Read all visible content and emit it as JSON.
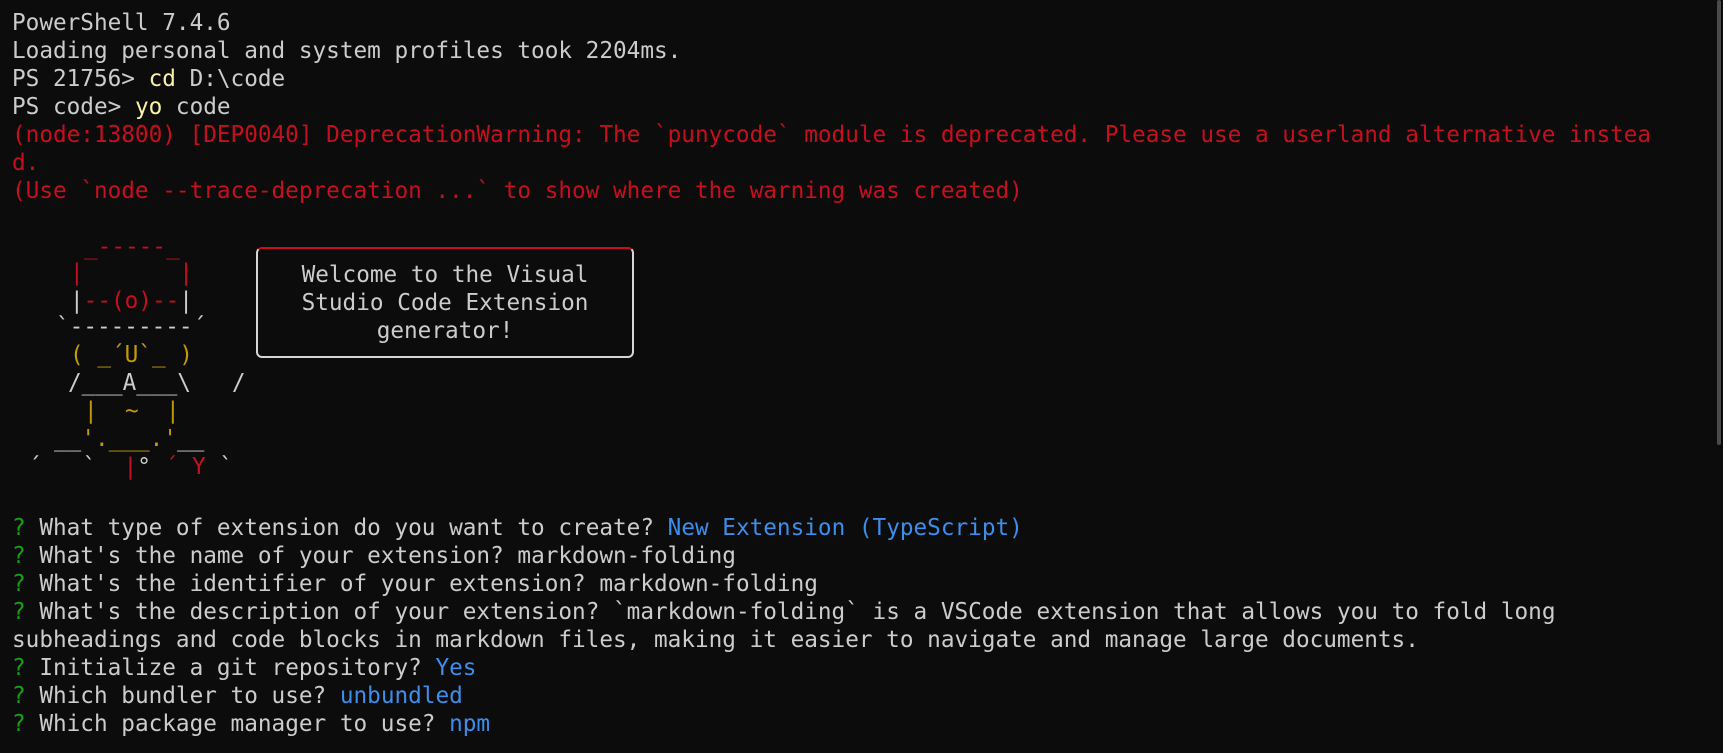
{
  "lines": {
    "l1": "PowerShell 7.4.6",
    "l2": "Loading personal and system profiles took 2204ms.",
    "l3_prompt": "PS 21756> ",
    "l3_cmd": "cd",
    "l3_arg": " D:\\code",
    "l4_prompt": "PS code> ",
    "l4_cmd": "yo",
    "l4_arg": " code",
    "l5": "(node:13800) [DEP0040] DeprecationWarning: The `punycode` module is deprecated. Please use a userland alternative instea",
    "l6": "d.",
    "l7": "(Use `node --trace-deprecation ...` to show where the warning was created)"
  },
  "ascii": {
    "a1": "_-----_",
    "a2_l": "|",
    "a2_r": "|",
    "a3_l": "|",
    "a3_m": "--(o)--",
    "a3_r": "|",
    "a4": "`---------´",
    "a5": "( _´U`_ )",
    "a6": "/___A___\\   /",
    "a7": "|  ~  |",
    "a8_a": "__",
    "a8_b": "'.___.'",
    "a8_c": "__",
    "a9_a": "´   `  ",
    "a9_b": "|",
    "a9_c": "° ",
    "a9_d": "´ Y",
    "a9_e": " `"
  },
  "welcome": {
    "line1": "Welcome to the Visual",
    "line2": "Studio Code Extension",
    "line3": "generator!"
  },
  "questions": [
    {
      "mark": "?",
      "text": " What type of extension do you want to create? ",
      "answer": "New Extension (TypeScript)"
    },
    {
      "mark": "?",
      "text": " What's the name of your extension? ",
      "answer": "markdown-folding"
    },
    {
      "mark": "?",
      "text": " What's the identifier of your extension? ",
      "answer": "markdown-folding"
    },
    {
      "mark": "?",
      "text": " What's the description of your extension? ",
      "answer": "`markdown-folding` is a VSCode extension that allows you to fold long"
    },
    {
      "mark": "",
      "text": "",
      "answer": "subheadings and code blocks in markdown files, making it easier to navigate and manage large documents."
    },
    {
      "mark": "?",
      "text": " Initialize a git repository? ",
      "answer": "Yes"
    },
    {
      "mark": "?",
      "text": " Which bundler to use? ",
      "answer": "unbundled"
    },
    {
      "mark": "?",
      "text": " Which package manager to use? ",
      "answer": "npm"
    }
  ],
  "colors": {
    "background": "#0c0c0c",
    "text": "#cccccc",
    "command": "#f9f1a5",
    "error": "#c50f1f",
    "question_mark": "#13a10e",
    "answer": "#3b8eea",
    "art_yellow": "#c19c00"
  }
}
